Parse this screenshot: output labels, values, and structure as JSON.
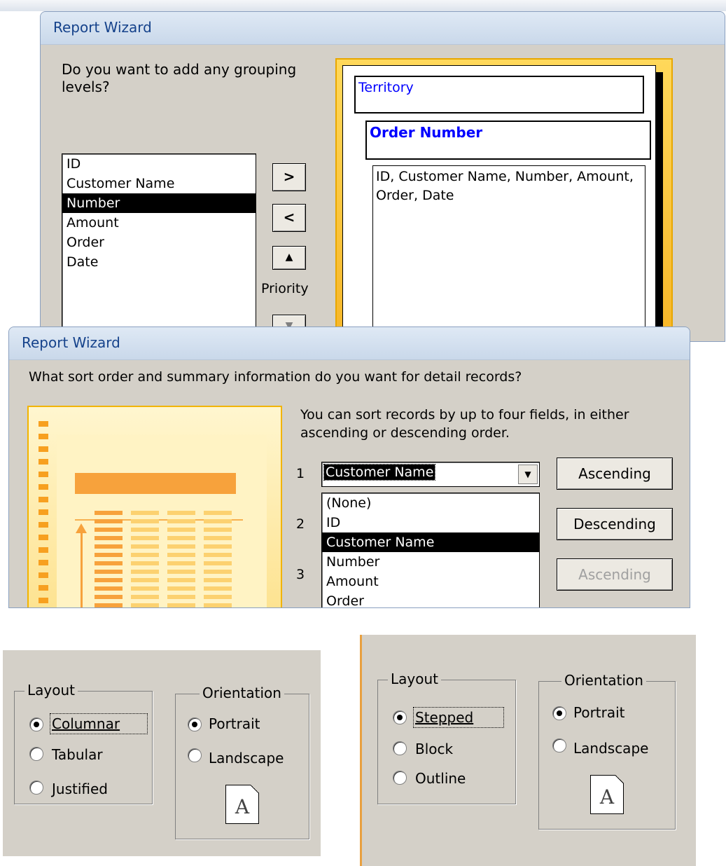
{
  "grouping_wizard": {
    "title": "Report Wizard",
    "question": "Do you want to add any grouping levels?",
    "fields": [
      "ID",
      "Customer Name",
      "Number",
      "Amount",
      "Order",
      "Date"
    ],
    "selected_field": "Number",
    "add_button": ">",
    "remove_button": "<",
    "priority_label": "Priority",
    "preview": {
      "group1": "Territory",
      "group2": "Order Number",
      "detail": "ID, Customer Name, Number, Amount, Order, Date"
    }
  },
  "sort_wizard": {
    "title": "Report Wizard",
    "question": "What sort order and summary information do you want for detail records?",
    "instruction": "You can sort records by up to four fields, in either ascending or descending order.",
    "rows": [
      "1",
      "2",
      "3"
    ],
    "sort1_value": "Customer Name",
    "dropdown_options": [
      "(None)",
      "ID",
      "Customer Name",
      "Number",
      "Amount",
      "Order"
    ],
    "selected_option": "Customer Name",
    "buttons": [
      "Ascending",
      "Descending",
      "Ascending"
    ]
  },
  "layout_panel_1": {
    "layout_legend": "Layout",
    "layout_options": [
      "Columnar",
      "Tabular",
      "Justified"
    ],
    "layout_selected": "Columnar",
    "orientation_legend": "Orientation",
    "orientation_options": [
      "Portrait",
      "Landscape"
    ],
    "orientation_selected": "Portrait",
    "page_letter": "A"
  },
  "layout_panel_2": {
    "layout_legend": "Layout",
    "layout_options": [
      "Stepped",
      "Block",
      "Outline"
    ],
    "layout_selected": "Stepped",
    "orientation_legend": "Orientation",
    "orientation_options": [
      "Portrait",
      "Landscape"
    ],
    "orientation_selected": "Portrait",
    "page_letter": "A"
  },
  "colors": {
    "dialog_bg": "#d4d0c8",
    "title_text": "#15428b",
    "preview_text": "#0000ff",
    "accent_yellow": "#f6b425"
  }
}
